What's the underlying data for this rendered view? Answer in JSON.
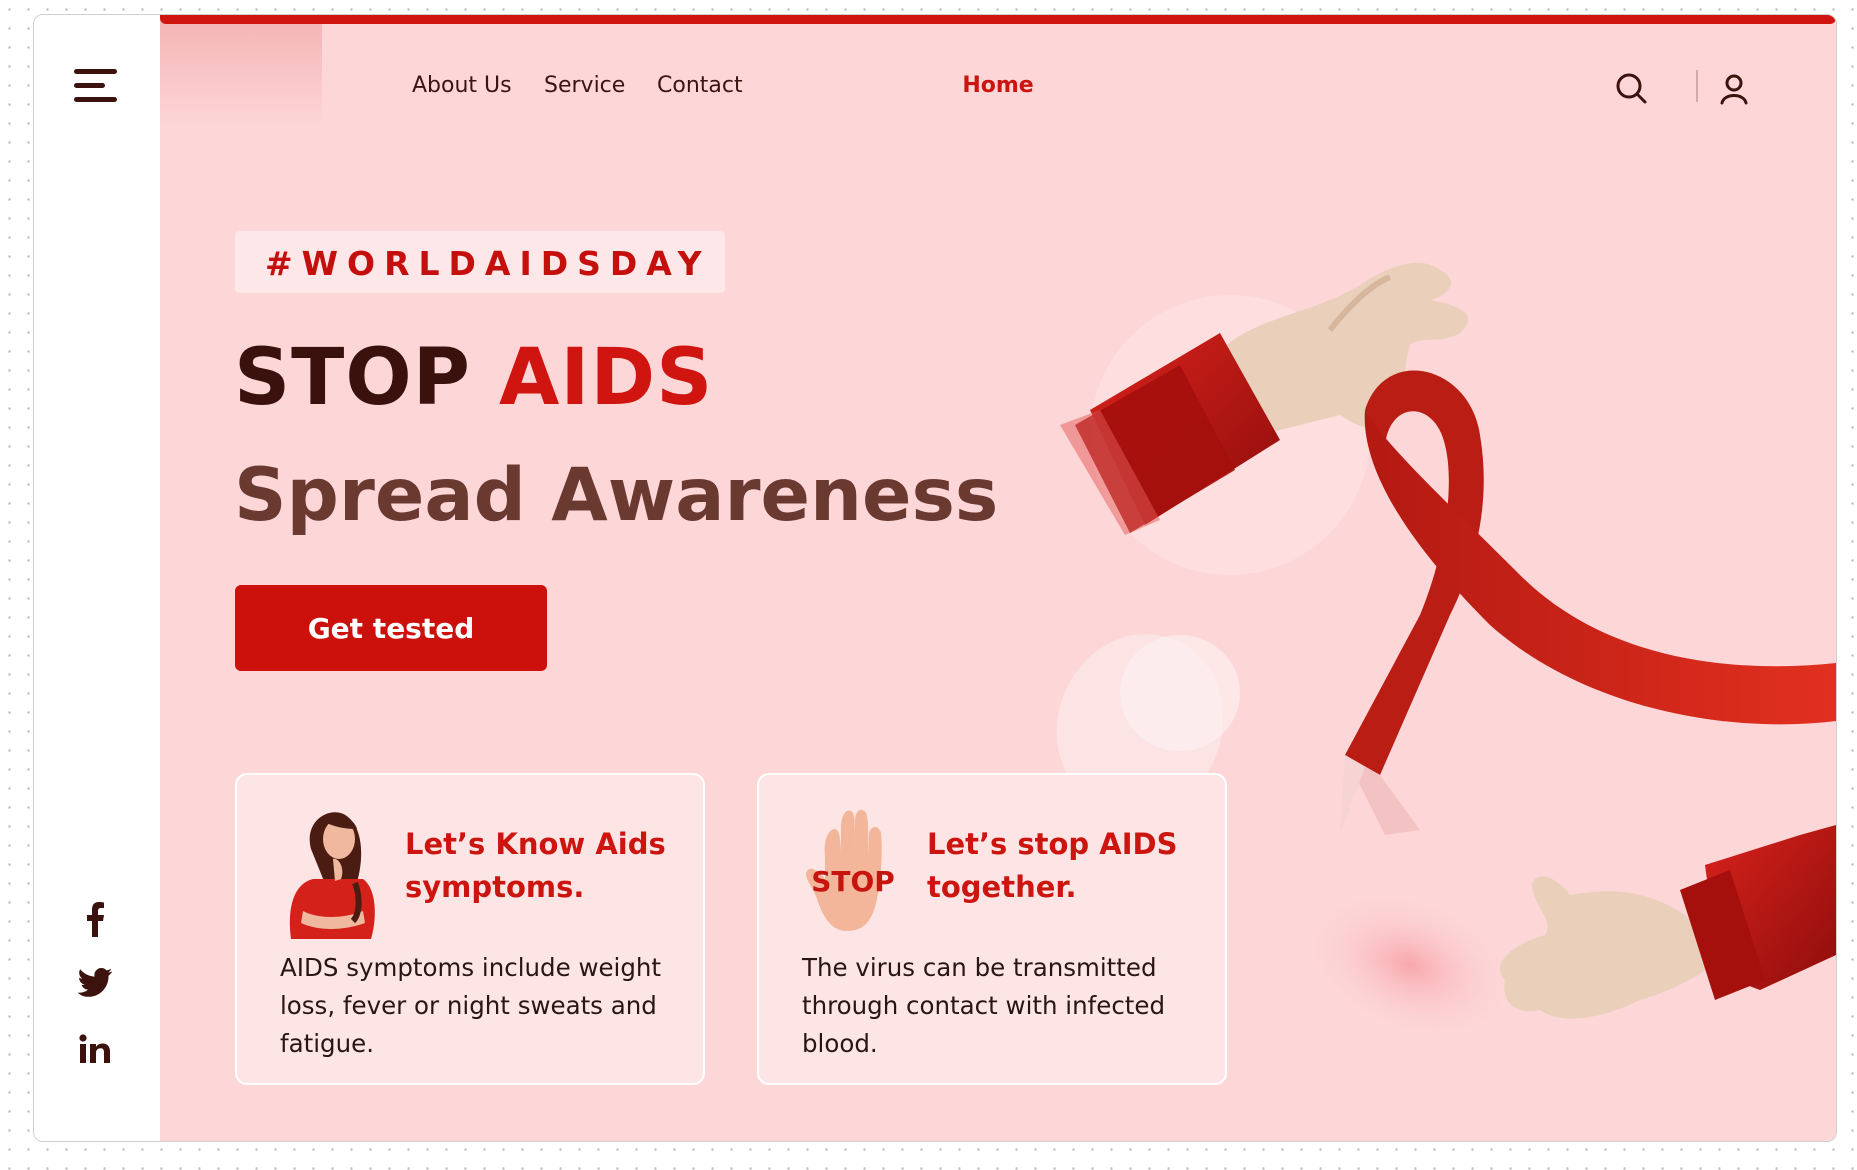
{
  "nav": {
    "items": [
      "Home",
      "About Us",
      "Service",
      "Contact"
    ]
  },
  "hero": {
    "tag": "#WORLDAIDSDAY",
    "title_dark": "STOP",
    "title_red": "AIDS",
    "subtitle": "Spread Awareness",
    "cta_label": "Get tested"
  },
  "cards": [
    {
      "title": "Let’s Know Aids symptoms.",
      "text": "AIDS symptoms include weight loss, fever or night sweats and fatigue."
    },
    {
      "title": "Let’s stop AIDS together.",
      "text": "The virus can be transmitted through contact with infected blood.",
      "sign_text": "STOP"
    }
  ],
  "social": [
    "facebook-icon",
    "twitter-icon",
    "linkedin-icon"
  ],
  "colors": {
    "accent": "#cc110c",
    "background": "#fdd6d8",
    "dark_text": "#3a110d",
    "subtitle": "#6a3a31"
  }
}
